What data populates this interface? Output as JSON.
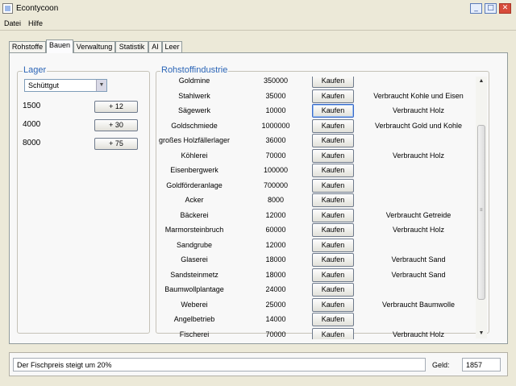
{
  "window": {
    "title": "Econtycoon",
    "minimize_glyph": "_",
    "maximize_glyph": "□",
    "close_glyph": "✕"
  },
  "menu": [
    "Datei",
    "Hilfe"
  ],
  "tabs": [
    "Rohstoffe",
    "Bauen",
    "Verwaltung",
    "Statistik",
    "AI",
    "Leer"
  ],
  "active_tab": "Bauen",
  "lager": {
    "title": "Lager",
    "select_value": "Schüttgut",
    "rows": [
      {
        "value": "1500",
        "button": "+ 12"
      },
      {
        "value": "4000",
        "button": "+ 30"
      },
      {
        "value": "8000",
        "button": "+ 75"
      }
    ]
  },
  "rohstoff": {
    "title": "Rohstoffindustrie",
    "button_label": "Kaufen",
    "rows": [
      {
        "name": "Goldmine",
        "price": "350000",
        "info": ""
      },
      {
        "name": "Stahlwerk",
        "price": "35000",
        "info": "Verbraucht Kohle und Eisen"
      },
      {
        "name": "Sägewerk",
        "price": "10000",
        "info": "Verbraucht Holz"
      },
      {
        "name": "Goldschmiede",
        "price": "1000000",
        "info": "Verbraucht Gold und Kohle"
      },
      {
        "name": "großes Holzfällerlager",
        "price": "36000",
        "info": ""
      },
      {
        "name": "Köhlerei",
        "price": "70000",
        "info": "Verbraucht Holz"
      },
      {
        "name": "Eisenbergwerk",
        "price": "100000",
        "info": ""
      },
      {
        "name": "Goldförderanlage",
        "price": "700000",
        "info": ""
      },
      {
        "name": "Acker",
        "price": "8000",
        "info": ""
      },
      {
        "name": "Bäckerei",
        "price": "12000",
        "info": "Verbraucht Getreide"
      },
      {
        "name": "Marmorsteinbruch",
        "price": "60000",
        "info": "Verbraucht Holz"
      },
      {
        "name": "Sandgrube",
        "price": "12000",
        "info": ""
      },
      {
        "name": "Glaserei",
        "price": "18000",
        "info": "Verbraucht Sand"
      },
      {
        "name": "Sandsteinmetz",
        "price": "18000",
        "info": "Verbraucht Sand"
      },
      {
        "name": "Baumwollplantage",
        "price": "24000",
        "info": ""
      },
      {
        "name": "Weberei",
        "price": "25000",
        "info": "Verbraucht Baumwolle"
      },
      {
        "name": "Angelbetrieb",
        "price": "14000",
        "info": ""
      },
      {
        "name": "Fischerei",
        "price": "70000",
        "info": "Verbraucht Holz"
      }
    ]
  },
  "status": {
    "message": "Der Fischpreis steigt um 20%",
    "geld_label": "Geld:",
    "geld_value": "1857"
  }
}
